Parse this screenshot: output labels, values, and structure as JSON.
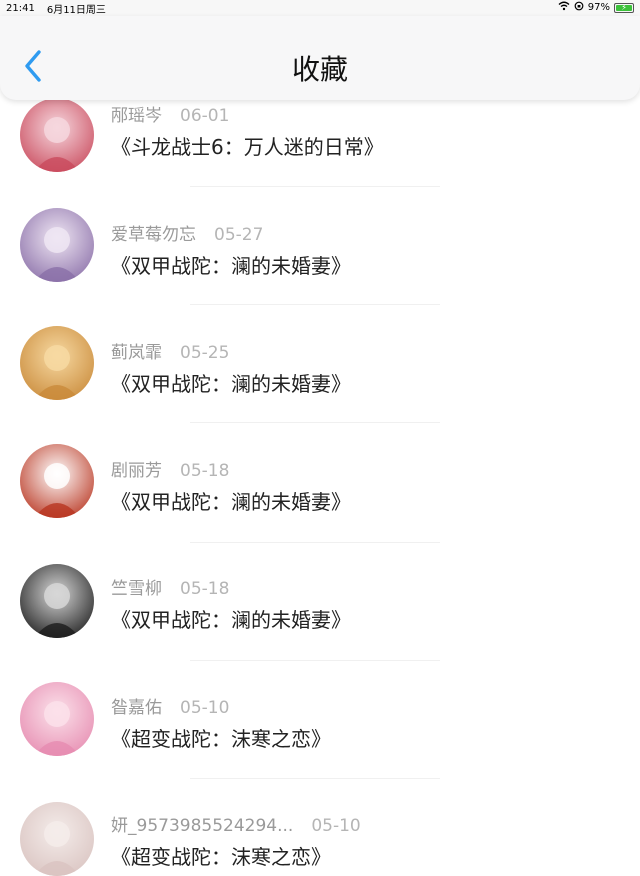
{
  "status_bar": {
    "time": "21:41",
    "date": "6月11日周三",
    "battery": "97%",
    "battery_level": 0.97
  },
  "header": {
    "title": "收藏"
  },
  "items": [
    {
      "user": "邴瑶岑",
      "date": "06-01",
      "title": "《斗龙战士6：万人迷的日常》",
      "avatar_colors": [
        "#f6d7de",
        "#c94a5c"
      ]
    },
    {
      "user": "爱草莓勿忘",
      "date": "05-27",
      "title": "《双甲战陀：澜的未婚妻》",
      "avatar_colors": [
        "#efe6f3",
        "#8a6fa8"
      ]
    },
    {
      "user": "蓟岚霏",
      "date": "05-25",
      "title": "《双甲战陀：澜的未婚妻》",
      "avatar_colors": [
        "#f7d9a2",
        "#c98a3a"
      ]
    },
    {
      "user": "剧丽芳",
      "date": "05-18",
      "title": "《双甲战陀：澜的未婚妻》",
      "avatar_colors": [
        "#ffffff",
        "#b8341f"
      ]
    },
    {
      "user": "竺雪柳",
      "date": "05-18",
      "title": "《双甲战陀：澜的未婚妻》",
      "avatar_colors": [
        "#d7d7d7",
        "#1c1c1c"
      ]
    },
    {
      "user": "昝嘉佑",
      "date": "05-10",
      "title": "《超变战陀：沫寒之恋》",
      "avatar_colors": [
        "#fbe1ea",
        "#e68bb0"
      ]
    },
    {
      "user": "妍_9573985524294...",
      "date": "05-10",
      "title": "《超变战陀：沫寒之恋》",
      "avatar_colors": [
        "#f4ecea",
        "#d9c3c0"
      ]
    }
  ],
  "colors": {
    "accent": "#2f9bf0",
    "header_bg": "#f7f7f8",
    "battery": "#3cc13b"
  }
}
